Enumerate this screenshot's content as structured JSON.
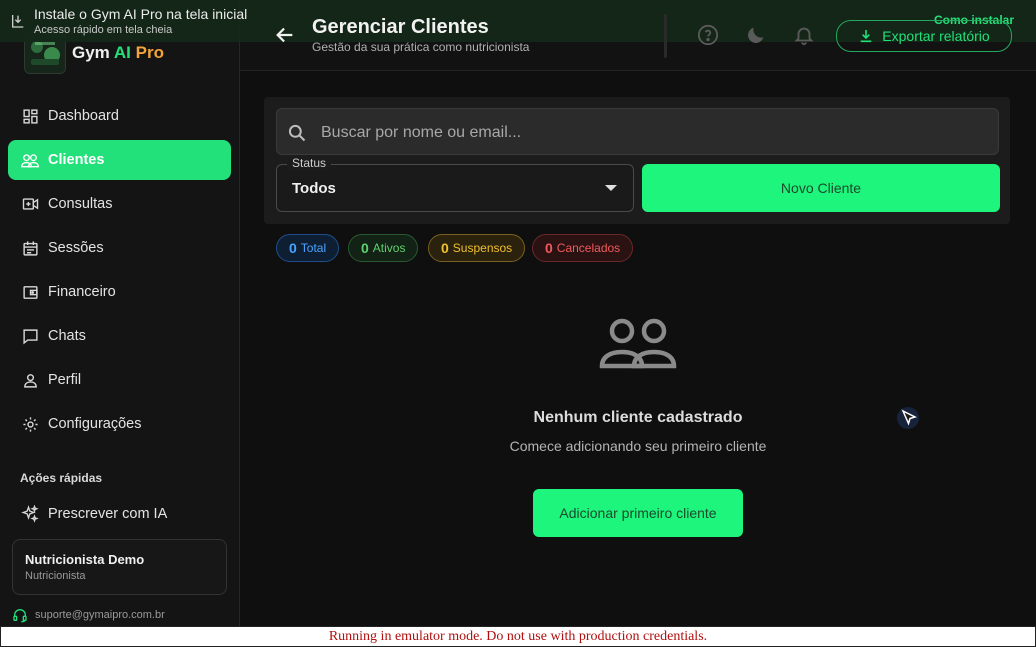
{
  "install_banner": {
    "title": "Instale o Gym AI Pro na tela inicial",
    "subtitle": "Acesso rápido em tela cheia",
    "link": "Como instalar",
    "icon": "install-app-icon"
  },
  "sidebar": {
    "logo": {
      "part1": "Gym ",
      "part2": "AI",
      "part3": " Pro"
    },
    "items": [
      {
        "label": "Dashboard",
        "icon": "dashboard-icon",
        "active": false
      },
      {
        "label": "Clientes",
        "icon": "users-icon",
        "active": true
      },
      {
        "label": "Consultas",
        "icon": "video-call-icon",
        "active": false
      },
      {
        "label": "Sessões",
        "icon": "calendar-icon",
        "active": false
      },
      {
        "label": "Financeiro",
        "icon": "wallet-icon",
        "active": false
      },
      {
        "label": "Chats",
        "icon": "chat-icon",
        "active": false
      },
      {
        "label": "Perfil",
        "icon": "person-icon",
        "active": false
      },
      {
        "label": "Configurações",
        "icon": "gear-icon",
        "active": false
      }
    ],
    "quick_actions_title": "Ações rápidas",
    "quick_actions": [
      {
        "label": "Prescrever com IA",
        "icon": "sparkles-icon"
      }
    ],
    "user": {
      "name": "Nutricionista Demo",
      "role": "Nutricionista"
    },
    "support_email": "suporte@gymaipro.com.br"
  },
  "header": {
    "title": "Gerenciar Clientes",
    "subtitle": "Gestão da sua prática como nutricionista",
    "export_label": "Exportar relatório",
    "icons": [
      "help-icon",
      "dark-mode-icon",
      "bell-icon"
    ]
  },
  "filters": {
    "search_placeholder": "Buscar por nome ou email...",
    "search_value": "",
    "status_label": "Status",
    "status_value": "Todos",
    "new_client_label": "Novo Cliente"
  },
  "chips": [
    {
      "count": "0",
      "label": "Total",
      "color": "#4aa3ff"
    },
    {
      "count": "0",
      "label": "Ativos",
      "color": "#5fd070"
    },
    {
      "count": "0",
      "label": "Suspensos",
      "color": "#f0c030"
    },
    {
      "count": "0",
      "label": "Cancelados",
      "color": "#f05a5a"
    }
  ],
  "empty_state": {
    "icon": "users-outline-icon",
    "title": "Nenhum cliente cadastrado",
    "subtitle": "Comece adicionando seu primeiro cliente",
    "button_label": "Adicionar primeiro cliente"
  },
  "emulator_notice": "Running in emulator mode. Do not use with production credentials.",
  "colors": {
    "accent": "#1ef57c",
    "background": "#0f0f0f",
    "sidebar": "#141414"
  }
}
